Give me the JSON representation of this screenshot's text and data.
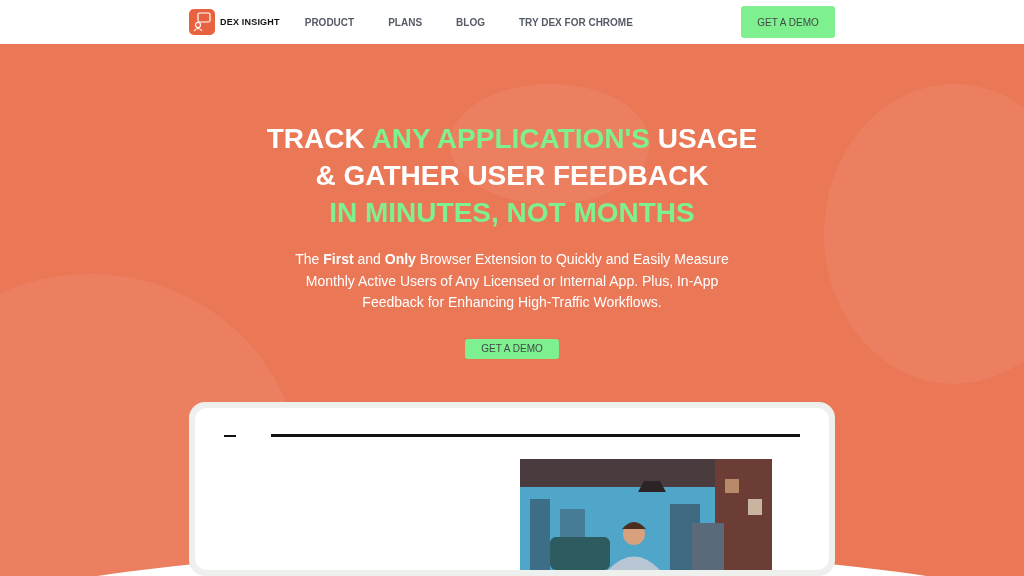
{
  "nav": {
    "brand": "DEX INSIGHT",
    "links": [
      "PRODUCT",
      "PLANS",
      "BLOG",
      "TRY DEX FOR CHROME"
    ],
    "cta": "GET A DEMO"
  },
  "hero": {
    "headline": [
      [
        {
          "text": "TRACK ",
          "highlight": false
        },
        {
          "text": "ANY APPLICATION'S",
          "highlight": true
        },
        {
          "text": " USAGE",
          "highlight": false
        }
      ],
      [
        {
          "text": "& GATHER USER FEEDBACK",
          "highlight": false
        }
      ],
      [
        {
          "text": "IN MINUTES, NOT MONTHS",
          "highlight": true
        }
      ]
    ],
    "subtitle": "The **First** and **Only** Browser Extension to Quickly and Easily Measure Monthly Active Users of Any Licensed or Internal App. Plus, In-App Feedback for Enhancing High-Traffic Workflows.",
    "cta": "GET A DEMO"
  }
}
